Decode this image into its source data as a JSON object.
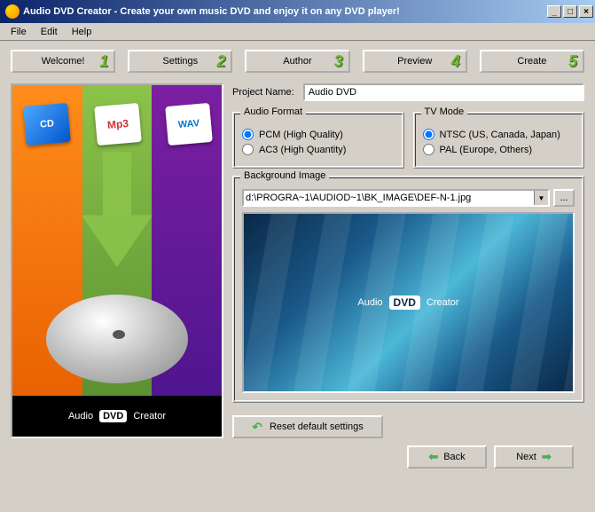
{
  "window": {
    "title": "Audio DVD Creator - Create your own music DVD and enjoy it on any DVD player!"
  },
  "menu": {
    "file": "File",
    "edit": "Edit",
    "help": "Help"
  },
  "steps": [
    {
      "label": "Welcome!",
      "num": "1"
    },
    {
      "label": "Settings",
      "num": "2"
    },
    {
      "label": "Author",
      "num": "3"
    },
    {
      "label": "Preview",
      "num": "4"
    },
    {
      "label": "Create",
      "num": "5"
    }
  ],
  "left": {
    "icon_cd": "CD",
    "brand_a": "Audio",
    "brand_dvd": "DVD",
    "brand_c": "Creator"
  },
  "project": {
    "label": "Project Name:",
    "value": "Audio DVD"
  },
  "audio_format": {
    "legend": "Audio Format",
    "pcm": "PCM (High Quality)",
    "ac3": "AC3 (High Quantity)",
    "selected": "pcm"
  },
  "tv_mode": {
    "legend": "TV Mode",
    "ntsc": "NTSC (US, Canada, Japan)",
    "pal": "PAL  (Europe, Others)",
    "selected": "ntsc"
  },
  "bg_image": {
    "legend": "Background Image",
    "path": "d:\\PROGRA~1\\AUDIOD~1\\BK_IMAGE\\DEF-N-1.jpg",
    "browse": "...",
    "preview_a": "Audio",
    "preview_dvd": "DVD",
    "preview_c": "Creator"
  },
  "reset": "Reset default settings",
  "nav": {
    "back": "Back",
    "next": "Next"
  }
}
